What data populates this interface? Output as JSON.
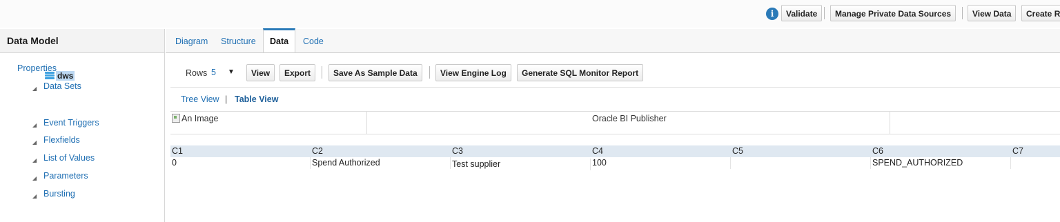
{
  "toolbar": {
    "info_icon": "i",
    "validate": "Validate",
    "manage_private_data_sources": "Manage Private Data Sources",
    "view_data": "View Data",
    "create_report": "Create R"
  },
  "left_panel": {
    "title": "Data Model",
    "properties": "Properties",
    "data_sets": "Data Sets",
    "data_set_item": "dws",
    "event_triggers": "Event Triggers",
    "flexfields": "Flexfields",
    "list_of_values": "List of Values",
    "parameters": "Parameters",
    "bursting": "Bursting"
  },
  "tabs": {
    "diagram": "Diagram",
    "structure": "Structure",
    "data": "Data",
    "code": "Code",
    "active": "Data"
  },
  "actions": {
    "rows_label": "Rows",
    "rows_value": "5",
    "view": "View",
    "export": "Export",
    "save_as_sample_data": "Save As Sample Data",
    "view_engine_log": "View Engine Log",
    "generate_sql_monitor_report": "Generate SQL Monitor Report"
  },
  "view_toggle": {
    "tree_view": "Tree View",
    "separator": "|",
    "table_view": "Table View"
  },
  "report_header": {
    "image_alt": "An Image",
    "title": "Oracle BI Publisher"
  },
  "table": {
    "columns": [
      "C1",
      "C2",
      "C3",
      "C4",
      "C5",
      "C6",
      "C7"
    ],
    "rows": [
      [
        "0",
        "Spend Authorized",
        "Test supplier",
        "100",
        "",
        "SPEND_AUTHORIZED",
        ""
      ]
    ]
  },
  "colors": {
    "link": "#1f6fb3",
    "accent": "#2a7ab8",
    "table_header": "#dfe8f1",
    "selection": "#bcd8f2"
  }
}
